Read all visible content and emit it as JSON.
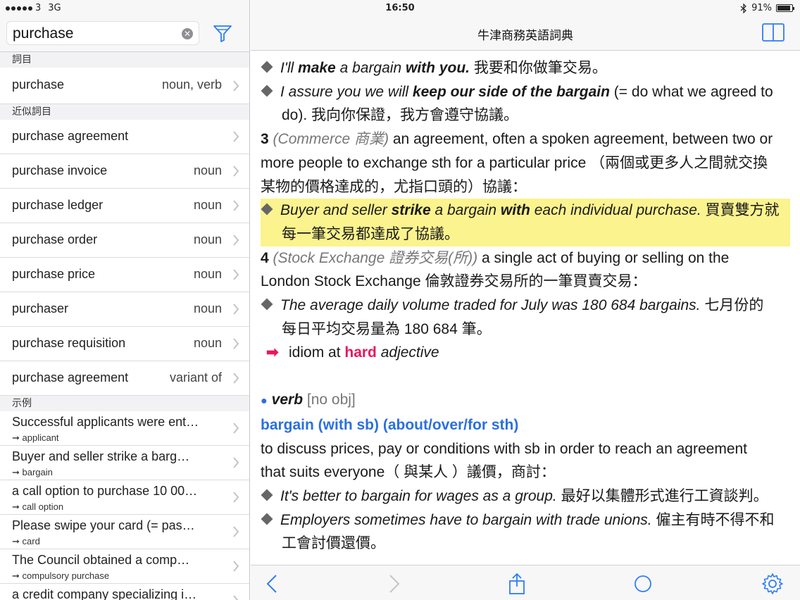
{
  "status": {
    "carrier": "3",
    "network": "3G",
    "time": "16:50",
    "battery": "91%",
    "battery_level": 0.91
  },
  "sidebar": {
    "search": {
      "value": "purchase",
      "placeholder": ""
    },
    "sections": {
      "headwords": "詞目",
      "similar": "近似詞目",
      "examples": "示例"
    },
    "headword": {
      "title": "purchase",
      "type": "noun, verb"
    },
    "similar_items": [
      {
        "title": "purchase agreement",
        "type": ""
      },
      {
        "title": "purchase invoice",
        "type": "noun"
      },
      {
        "title": "purchase ledger",
        "type": "noun"
      },
      {
        "title": "purchase order",
        "type": "noun"
      },
      {
        "title": "purchase price",
        "type": "noun"
      },
      {
        "title": "purchaser",
        "type": "noun"
      },
      {
        "title": "purchase requisition",
        "type": "noun"
      },
      {
        "title": "purchase agreement",
        "type": "variant of"
      }
    ],
    "example_items": [
      {
        "title": "Successful applicants were ent…",
        "sub": "➞ applicant"
      },
      {
        "title": "Buyer and seller  strike  a barg…",
        "sub": "➞ bargain"
      },
      {
        "title": "a call option to purchase 10 00…",
        "sub": "➞ call option"
      },
      {
        "title": "Please swipe your card  (= pas…",
        "sub": "➞ card"
      },
      {
        "title": "The Council obtained a  comp…",
        "sub": "➞ compulsory purchase"
      },
      {
        "title": "a credit company specializing i…",
        "sub": ""
      }
    ]
  },
  "main": {
    "title": "牛津商務英語詞典",
    "entry": {
      "ex1": {
        "a": "I'll ",
        "b": "make",
        "c": " a bargain ",
        "d": "with you.",
        "zh": " 我要和你做筆交易。"
      },
      "ex2": {
        "a": "I assure you we will ",
        "b": "keep our side of the bargain",
        "c": " (= do what we agreed to",
        "cont": "do). 我向你保證，我方會遵守協議。"
      },
      "sense3": {
        "num": "3",
        "label": "(Commerce 商業)",
        "def1": " an agreement, often a spoken agreement, between two or",
        "def2": "more people to exchange sth for a particular price （兩個或更多人之間就交換",
        "def3": "某物的價格達成的，尤指口頭的）協議："
      },
      "ex3": {
        "a": "Buyer and seller ",
        "b": "strike",
        "c": " a bargain ",
        "d": "with",
        "e": " each individual purchase.",
        "zh": " 買賣雙方就",
        "cont": "每一筆交易都達成了協議。"
      },
      "sense4": {
        "num": "4",
        "label": "(Stock Exchange 證券交易(所))",
        "def1": " a single act of buying or selling on the",
        "def2": "London Stock Exchange 倫敦證券交易所的一筆買賣交易："
      },
      "ex4": {
        "a": "The average daily volume traded for July was 180 684 bargains.",
        "zh": " 七月份的",
        "cont": "每日平均交易量為 180 684 筆。"
      },
      "idiom": {
        "arrow": "➡",
        "pre": "idiom at ",
        "word": "hard",
        "pos": " adjective"
      },
      "verb": {
        "pos": "verb",
        "gram": " [no obj]"
      },
      "phrase": "bargain (with sb) (about/over/for sth)",
      "verb_def1": "to discuss prices, pay or conditions with sb in order to reach an agreement",
      "verb_def2": "that suits everyone（ 與某人 ）議價，商討：",
      "ex5": {
        "a": "It's better to bargain for wages as a group.",
        "zh": " 最好以集體形式進行工資談判。"
      },
      "ex6": {
        "a": "Employers sometimes have to bargain with trade unions.",
        "zh": " 僱主有時不得不和",
        "cont": "工會討價還價。"
      }
    }
  },
  "colors": {
    "highlight": "#fbf38e",
    "link_blue": "#2b6fe0",
    "accent_red": "#e5185c",
    "ios_blue": "#2f7cf6"
  },
  "icons": [
    "filter-icon",
    "clear-icon",
    "book-icon",
    "back-icon",
    "forward-icon",
    "share-icon",
    "circle-icon",
    "gear-icon",
    "bluetooth-icon",
    "chevron-right-icon"
  ]
}
